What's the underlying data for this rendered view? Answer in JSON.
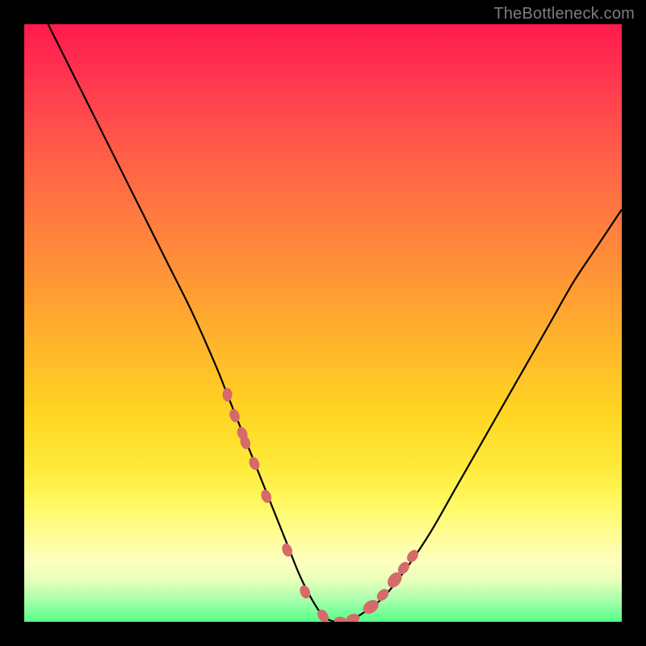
{
  "watermark": "TheBottleneck.com",
  "chart_data": {
    "type": "line",
    "title": "",
    "xlabel": "",
    "ylabel": "",
    "xlim": [
      0,
      100
    ],
    "ylim": [
      0,
      100
    ],
    "grid": false,
    "legend": false,
    "series": [
      {
        "name": "bottleneck-curve",
        "x": [
          4,
          8,
          12,
          16,
          20,
          24,
          28,
          32,
          34,
          36,
          38,
          40,
          42,
          44,
          46,
          48,
          50,
          52,
          54,
          56,
          60,
          64,
          68,
          72,
          76,
          80,
          84,
          88,
          92,
          96,
          100
        ],
        "y": [
          100,
          92,
          84,
          76,
          68,
          60,
          52,
          43,
          38,
          33,
          28,
          23,
          18,
          13,
          8,
          4,
          1,
          0,
          0,
          1,
          4,
          9,
          15,
          22,
          29,
          36,
          43,
          50,
          57,
          63,
          69
        ]
      }
    ],
    "markers": {
      "name": "highlight-points",
      "color": "#d66a6a",
      "x": [
        34.0,
        35.2,
        36.5,
        37.0,
        38.5,
        40.5,
        44.0,
        47.0,
        50.0,
        53.0,
        55.0,
        58.0,
        60.0,
        62.0,
        63.5,
        65.0
      ],
      "y": [
        38.0,
        34.5,
        31.5,
        30.0,
        26.5,
        21.0,
        12.0,
        5.0,
        1.0,
        0.0,
        0.5,
        2.5,
        4.5,
        7.0,
        9.0,
        11.0
      ],
      "size": [
        8,
        8,
        8,
        8,
        8,
        8,
        8,
        8,
        8,
        8,
        8,
        10,
        8,
        10,
        8,
        8
      ]
    }
  },
  "colors": {
    "background": "#000000",
    "curve": "#000000",
    "marker": "#d66a6a",
    "gradient_top": "#ff1a4d",
    "gradient_bottom": "#55ff88"
  }
}
